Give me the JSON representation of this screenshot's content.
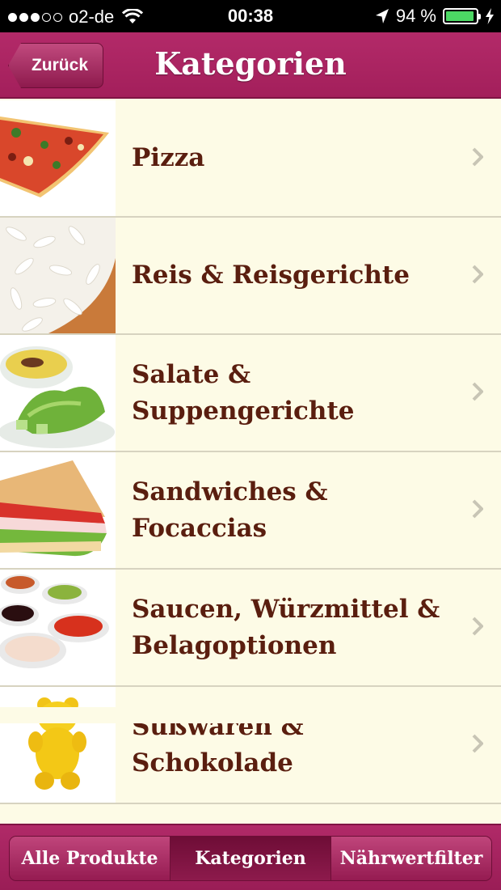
{
  "status_bar": {
    "carrier": "o2-de",
    "time": "00:38",
    "battery": "94 %",
    "battery_level": 0.94,
    "signal_bars_filled": 3,
    "signal_bars_total": 5
  },
  "nav": {
    "back_label": "Zurück",
    "title": "Kategorien"
  },
  "categories": [
    {
      "label": "Pizza",
      "image": "pizza"
    },
    {
      "label": "Reis & Reisgerichte",
      "image": "rice"
    },
    {
      "label": "Salate & Suppengerichte",
      "image": "salad-soup"
    },
    {
      "label": "Sandwiches & Focaccias",
      "image": "sandwich"
    },
    {
      "label": "Saucen, Würzmittel & Belagoptionen",
      "image": "sauces"
    },
    {
      "label": "Süßwaren & Schokolade",
      "image": "gummy-bear"
    }
  ],
  "tabs": [
    {
      "label": "Alle Produkte",
      "active": false
    },
    {
      "label": "Kategorien",
      "active": true
    },
    {
      "label": "Nährwertfilter",
      "active": false
    }
  ],
  "colors": {
    "bar": "#a31f5b",
    "list_background": "#fdfbe6",
    "label_text": "#5a1e0f"
  },
  "icons": {
    "row_chevron": "chevron-right-icon",
    "location": "location-arrow-icon",
    "wifi": "wifi-icon",
    "battery": "battery-icon",
    "charging": "charging-bolt-icon"
  }
}
